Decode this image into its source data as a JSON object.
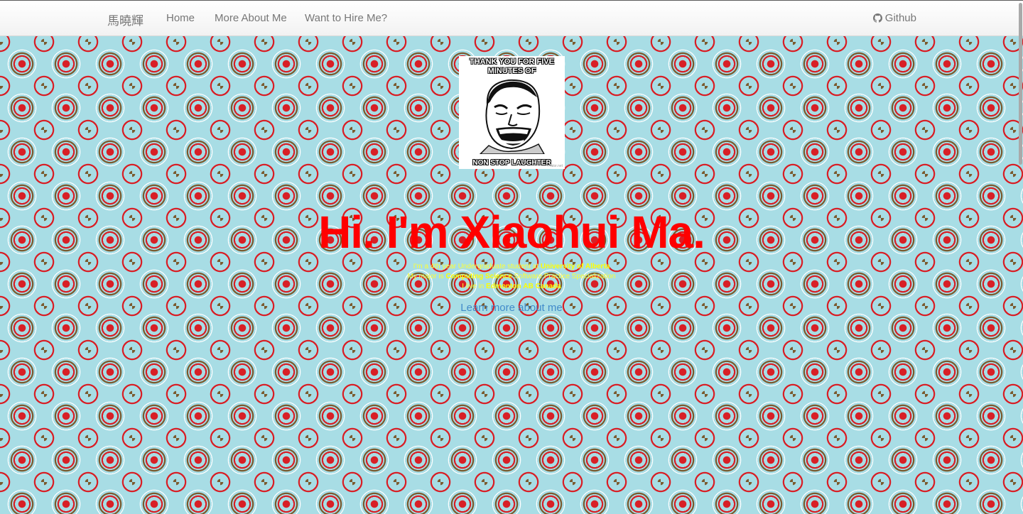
{
  "navbar": {
    "brand": "馬曉輝",
    "links": [
      "Home",
      "More About Me",
      "Want to Hire Me?"
    ],
    "github_label": "Github"
  },
  "avatar": {
    "top_text": "THANK YOU FOR FIVE MINUTES OF",
    "bottom_text": "NON STOP LAUGHTER",
    "watermark": "...rator.net"
  },
  "hero": {
    "headline": "Hi. I'm Xiaohui Ma.",
    "line1_prefix": "I'm a 4th year Undergraduate student at ",
    "line1_bold": "University of Alberta",
    "line2_prefix": "My major is ",
    "line2_bold": "Computing Science",
    "line2_suffix": " Software Practice Specialization",
    "line3_prefix": "I live in ",
    "line3_bold1": "Edmonton",
    "line3_sep": " ",
    "line3_bold2": "AB Canada",
    "learn_more": "Learn more about me"
  },
  "colors": {
    "background": "#a8dde5",
    "headline": "#ff0000",
    "intro_text": "#ffff33",
    "link": "#428bca"
  },
  "icons": {
    "github": "github-icon",
    "avatar": "meme-face-icon"
  }
}
